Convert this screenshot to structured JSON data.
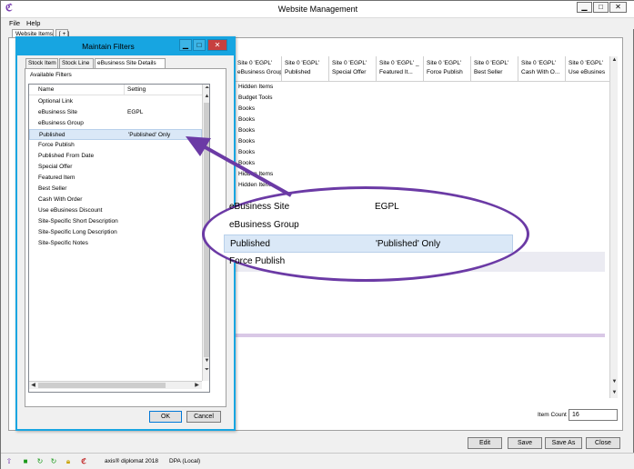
{
  "window": {
    "title": "Website Management",
    "min_label": "▁",
    "max_label": "□",
    "close_label": "✕"
  },
  "menu": {
    "file": "File",
    "help": "Help"
  },
  "main_tabs": {
    "website_items": "Website Items",
    "add": "[ + ]"
  },
  "grid": {
    "columns": [
      {
        "line1": "Site 0 'EGPL'",
        "line2": "eBusiness Group"
      },
      {
        "line1": "Site 0 'EGPL'",
        "line2": "Published"
      },
      {
        "line1": "Site 0 'EGPL'",
        "line2": "Special Offer"
      },
      {
        "line1": "Site 0 'EGPL' _",
        "line2": "Featured It..."
      },
      {
        "line1": "Site 0 'EGPL'",
        "line2": "Force Publish"
      },
      {
        "line1": "Site 0 'EGPL'",
        "line2": "Best Seller"
      },
      {
        "line1": "Site 0 'EGPL'",
        "line2": "Cash With O..."
      },
      {
        "line1": "Site 0 'EGPL'",
        "line2": "Use eBusines"
      }
    ],
    "rows": [
      "Hidden Items",
      "Budget Tools",
      "Books",
      "Books",
      "Books",
      "Books",
      "Books",
      "Books",
      "Hidden Items",
      "Hidden Items"
    ]
  },
  "item_count": {
    "label": "Item Count",
    "value": "16"
  },
  "buttons": {
    "edit": "Edit",
    "save": "Save",
    "save_as": "Save As",
    "close": "Close"
  },
  "status": {
    "product": "axis® diplomat 2018",
    "db": "DPA (Local)"
  },
  "dialog": {
    "title": "Maintain Filters",
    "tabs": {
      "stock_item": "Stock Item",
      "stock_line": "Stock Line",
      "ebusiness": "eBusiness Site Details"
    },
    "available_label": "Available Filters",
    "col_name": "Name",
    "col_setting": "Setting",
    "filters": [
      {
        "name": "Optional Link",
        "setting": ""
      },
      {
        "name": "eBusiness Site",
        "setting": "EGPL"
      },
      {
        "name": "eBusiness Group",
        "setting": ""
      },
      {
        "name": "Published",
        "setting": "'Published' Only"
      },
      {
        "name": "Force Publish",
        "setting": ""
      },
      {
        "name": "Published From Date",
        "setting": ""
      },
      {
        "name": "Special Offer",
        "setting": ""
      },
      {
        "name": "Featured Item",
        "setting": ""
      },
      {
        "name": "Best Seller",
        "setting": ""
      },
      {
        "name": "Cash With Order",
        "setting": ""
      },
      {
        "name": "Use eBusiness Discount",
        "setting": ""
      },
      {
        "name": "Site-Specific Short Description",
        "setting": ""
      },
      {
        "name": "Site-Specific Long Description",
        "setting": ""
      },
      {
        "name": "Site-Specific Notes",
        "setting": ""
      }
    ],
    "ok": "OK",
    "cancel": "Cancel"
  },
  "zoom": {
    "rows": [
      {
        "name": "eBusiness Site",
        "setting": "EGPL"
      },
      {
        "name": "eBusiness Group",
        "setting": ""
      },
      {
        "name": "Published",
        "setting": "'Published' Only"
      },
      {
        "name": "Force Publish",
        "setting": ""
      }
    ]
  },
  "colors": {
    "accent": "#17a5e1",
    "callout": "#6b3aa5",
    "selection": "#dae8f7"
  }
}
